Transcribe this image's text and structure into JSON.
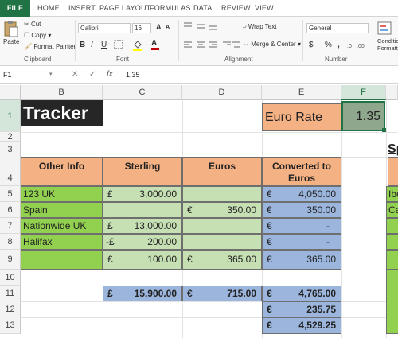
{
  "ribbon_tabs": [
    "FILE",
    "HOME",
    "INSERT",
    "PAGE LAYOUT",
    "FORMULAS",
    "DATA",
    "REVIEW",
    "VIEW"
  ],
  "clipboard": {
    "paste": "Paste",
    "cut": "Cut",
    "copy": "Copy",
    "format_painter": "Format Painter",
    "group": "Clipboard"
  },
  "font": {
    "name": "Calibri",
    "size": "16",
    "bold": "B",
    "italic": "I",
    "underline": "U",
    "group": "Font",
    "grow": "A",
    "shrink": "A",
    "font_color": "A"
  },
  "alignment": {
    "wrap": "Wrap Text",
    "merge": "Merge & Center",
    "group": "Alignment"
  },
  "number": {
    "format": "General",
    "currency": "$",
    "percent": "%",
    "comma": ",",
    "group": "Number"
  },
  "styles": {
    "conditional": "Conditional Formatting"
  },
  "formula_bar": {
    "name_box": "F1",
    "cancel": "✕",
    "enter": "✓",
    "fx": "fx",
    "value": "1.35"
  },
  "columns": [
    "B",
    "C",
    "D",
    "E",
    "F"
  ],
  "rows": [
    "1",
    "2",
    "3",
    "4",
    "5",
    "6",
    "7",
    "8",
    "9",
    "10",
    "11",
    "12",
    "13"
  ],
  "sheet": {
    "title": "Tracker",
    "euro_rate_label": "Euro Rate",
    "euro_rate_value": "1.35",
    "side_header": "Sp",
    "headers": {
      "other": "Other Info",
      "sterling": "Sterling",
      "euros": "Euros",
      "converted": "Converted to Euros"
    },
    "rows": [
      {
        "label": "123 UK",
        "ster_sym": "£",
        "ster": "3,000.00",
        "eur_sym": "",
        "eur": "",
        "conv_sym": "€",
        "conv": "4,050.00",
        "side": "Ibe"
      },
      {
        "label": "Spain",
        "ster_sym": "",
        "ster": "",
        "eur_sym": "€",
        "eur": "350.00",
        "conv_sym": "€",
        "conv": "350.00",
        "side": "Cas"
      },
      {
        "label": "Nationwide UK",
        "ster_sym": "£",
        "ster": "13,000.00",
        "eur_sym": "",
        "eur": "",
        "conv_sym": "€",
        "conv": "-",
        "side": ""
      },
      {
        "label": "Halifax",
        "ster_sym": "-£",
        "ster": "200.00",
        "eur_sym": "",
        "eur": "",
        "conv_sym": "€",
        "conv": "-",
        "side": ""
      },
      {
        "label": "",
        "ster_sym": "£",
        "ster": "100.00",
        "eur_sym": "€",
        "eur": "365.00",
        "conv_sym": "€",
        "conv": "365.00",
        "side": ""
      }
    ],
    "totals": {
      "ster_sym": "£",
      "ster": "15,900.00",
      "eur_sym": "€",
      "eur": "715.00",
      "conv_sym": "€",
      "conv": "4,765.00"
    },
    "row12": {
      "sym": "€",
      "value": "235.75"
    },
    "row13": {
      "sym": "€",
      "value": "4,529.25"
    }
  },
  "colors": {
    "excel_green": "#217346",
    "orange": "#f4b183",
    "green": "#92d050",
    "light_green": "#c6e0b4",
    "blue": "#9bb5dc"
  }
}
